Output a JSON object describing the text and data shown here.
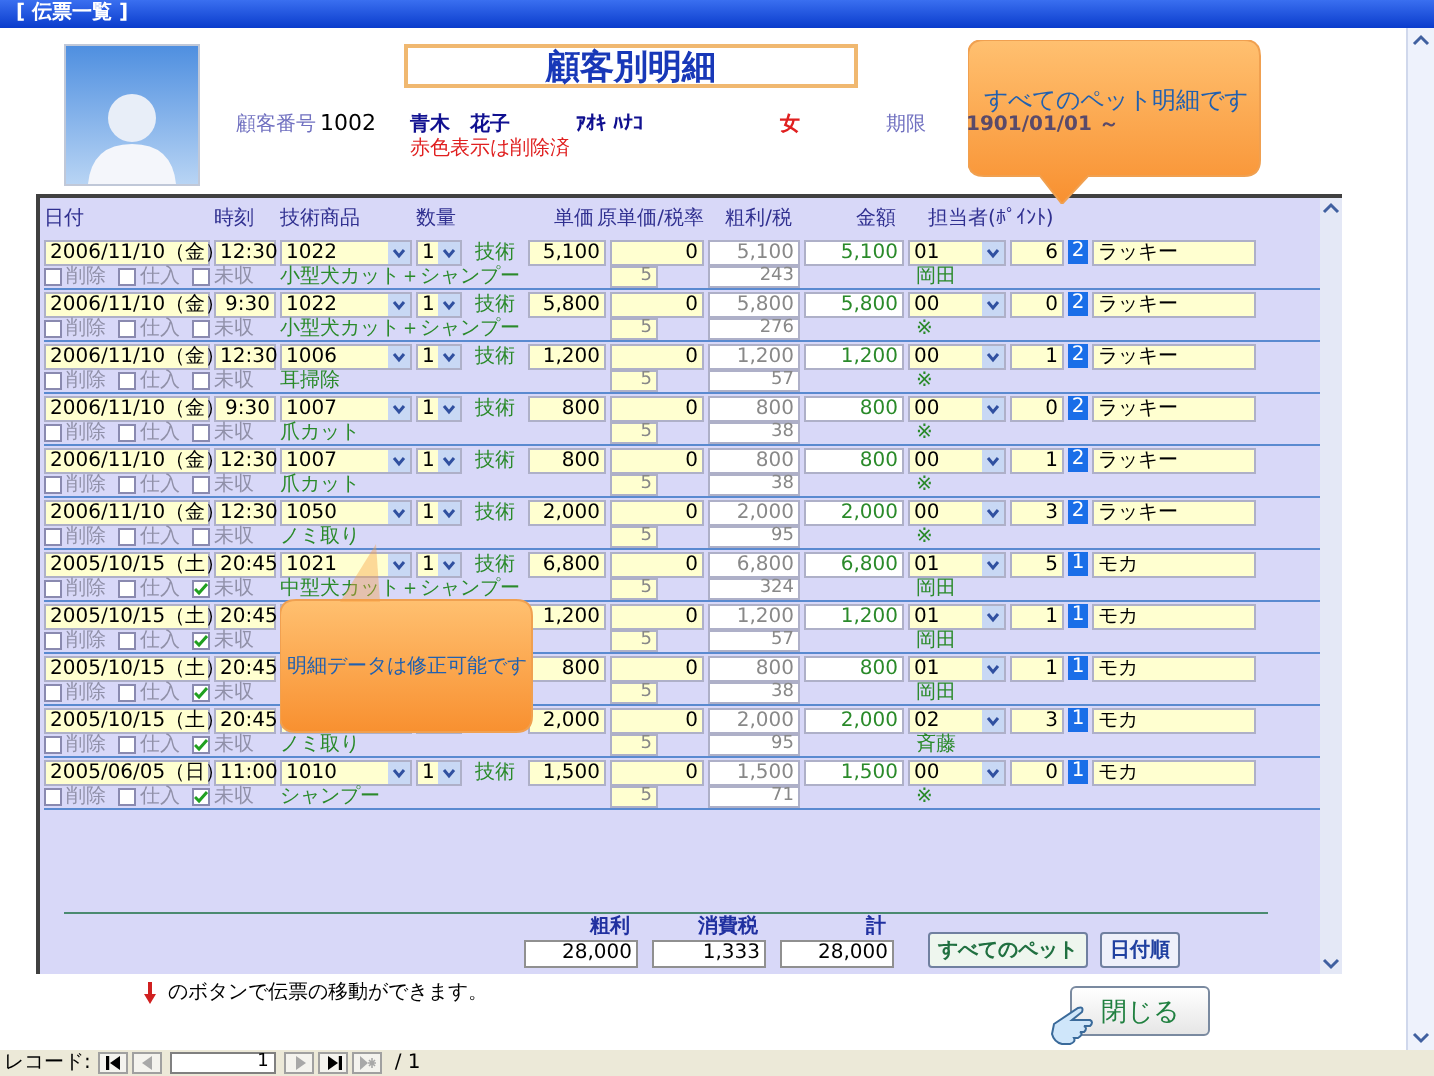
{
  "window": {
    "title": "[ 伝票一覧 ]"
  },
  "form_title": "顧客別明細",
  "customer": {
    "number_label": "顧客番号",
    "number": "1002",
    "name": "青木　花子",
    "deleted_note": "赤色表示は削除済",
    "kana": "ｱｵｷ ﾊﾅｺ",
    "gender": "女",
    "expiry_label": "期限",
    "expiry": "1901/01/01 ～"
  },
  "callouts": [
    {
      "text": "すべてのペット明細です"
    },
    {
      "text": "明細データは修正可能です"
    }
  ],
  "columns": [
    "日付",
    "時刻",
    "技術商品",
    "数量",
    "単価",
    "原単価/税率",
    "粗利/税",
    "金額",
    "担当者(ﾎﾟｲﾝﾄ)"
  ],
  "rows": [
    {
      "date": "2006/11/10（金）",
      "time": "12:30",
      "code": "1022",
      "qty": "1",
      "type": "技術",
      "unit_price": "5,100",
      "cost": "0",
      "gross": "5,100",
      "amount": "5,100",
      "staff_code": "01",
      "points": "6",
      "pet_no": "2",
      "pet": "ラッキー",
      "delete_label": "削除",
      "deleted": false,
      "purchase_label": "仕入",
      "purchase": false,
      "unpaid_label": "未収",
      "unpaid": false,
      "product": "小型犬カット＋シャンプー",
      "tax_rate": "5",
      "tax": "243",
      "staff": "岡田"
    },
    {
      "date": "2006/11/10（金）",
      "time": "9:30",
      "code": "1022",
      "qty": "1",
      "type": "技術",
      "unit_price": "5,800",
      "cost": "0",
      "gross": "5,800",
      "amount": "5,800",
      "staff_code": "00",
      "points": "0",
      "pet_no": "2",
      "pet": "ラッキー",
      "delete_label": "削除",
      "deleted": false,
      "purchase_label": "仕入",
      "purchase": false,
      "unpaid_label": "未収",
      "unpaid": false,
      "product": "小型犬カット＋シャンプー",
      "tax_rate": "5",
      "tax": "276",
      "staff": "※"
    },
    {
      "date": "2006/11/10（金）",
      "time": "12:30",
      "code": "1006",
      "qty": "1",
      "type": "技術",
      "unit_price": "1,200",
      "cost": "0",
      "gross": "1,200",
      "amount": "1,200",
      "staff_code": "00",
      "points": "1",
      "pet_no": "2",
      "pet": "ラッキー",
      "delete_label": "削除",
      "deleted": false,
      "purchase_label": "仕入",
      "purchase": false,
      "unpaid_label": "未収",
      "unpaid": false,
      "product": "耳掃除",
      "tax_rate": "5",
      "tax": "57",
      "staff": "※"
    },
    {
      "date": "2006/11/10（金）",
      "time": "9:30",
      "code": "1007",
      "qty": "1",
      "type": "技術",
      "unit_price": "800",
      "cost": "0",
      "gross": "800",
      "amount": "800",
      "staff_code": "00",
      "points": "0",
      "pet_no": "2",
      "pet": "ラッキー",
      "delete_label": "削除",
      "deleted": false,
      "purchase_label": "仕入",
      "purchase": false,
      "unpaid_label": "未収",
      "unpaid": false,
      "product": "爪カット",
      "tax_rate": "5",
      "tax": "38",
      "staff": "※"
    },
    {
      "date": "2006/11/10（金）",
      "time": "12:30",
      "code": "1007",
      "qty": "1",
      "type": "技術",
      "unit_price": "800",
      "cost": "0",
      "gross": "800",
      "amount": "800",
      "staff_code": "00",
      "points": "1",
      "pet_no": "2",
      "pet": "ラッキー",
      "delete_label": "削除",
      "deleted": false,
      "purchase_label": "仕入",
      "purchase": false,
      "unpaid_label": "未収",
      "unpaid": false,
      "product": "爪カット",
      "tax_rate": "5",
      "tax": "38",
      "staff": "※"
    },
    {
      "date": "2006/11/10（金）",
      "time": "12:30",
      "code": "1050",
      "qty": "1",
      "type": "技術",
      "unit_price": "2,000",
      "cost": "0",
      "gross": "2,000",
      "amount": "2,000",
      "staff_code": "00",
      "points": "3",
      "pet_no": "2",
      "pet": "ラッキー",
      "delete_label": "削除",
      "deleted": false,
      "purchase_label": "仕入",
      "purchase": false,
      "unpaid_label": "未収",
      "unpaid": false,
      "product": "ノミ取り",
      "tax_rate": "5",
      "tax": "95",
      "staff": "※"
    },
    {
      "date": "2005/10/15（土）",
      "time": "20:45",
      "code": "1021",
      "qty": "1",
      "type": "技術",
      "unit_price": "6,800",
      "cost": "0",
      "gross": "6,800",
      "amount": "6,800",
      "staff_code": "01",
      "points": "5",
      "pet_no": "1",
      "pet": "モカ",
      "delete_label": "削除",
      "deleted": false,
      "purchase_label": "仕入",
      "purchase": false,
      "unpaid_label": "未収",
      "unpaid": true,
      "product": "中型犬カット＋シャンプー",
      "tax_rate": "5",
      "tax": "324",
      "staff": "岡田"
    },
    {
      "date": "2005/10/15（土）",
      "time": "20:45",
      "unit_price": "1,200",
      "cost": "0",
      "gross": "1,200",
      "amount": "1,200",
      "staff_code": "01",
      "points": "1",
      "pet_no": "1",
      "pet": "モカ",
      "delete_label": "削除",
      "deleted": false,
      "purchase_label": "仕入",
      "purchase": false,
      "unpaid_label": "未収",
      "unpaid": true,
      "tax_rate": "5",
      "tax": "57",
      "staff": "岡田"
    },
    {
      "date": "2005/10/15（土）",
      "time": "20:45",
      "unit_price": "800",
      "cost": "0",
      "gross": "800",
      "amount": "800",
      "staff_code": "01",
      "points": "1",
      "pet_no": "1",
      "pet": "モカ",
      "delete_label": "削除",
      "deleted": false,
      "purchase_label": "仕入",
      "purchase": false,
      "unpaid_label": "未収",
      "unpaid": true,
      "tax_rate": "5",
      "tax": "38",
      "staff": "岡田"
    },
    {
      "date": "2005/10/15（土）",
      "time": "20:45",
      "unit_price": "2,000",
      "cost": "0",
      "gross": "2,000",
      "amount": "2,000",
      "staff_code": "02",
      "points": "3",
      "pet_no": "1",
      "pet": "モカ",
      "delete_label": "削除",
      "deleted": false,
      "purchase_label": "仕入",
      "purchase": false,
      "unpaid_label": "未収",
      "unpaid": true,
      "product": "ノミ取り",
      "tax_rate": "5",
      "tax": "95",
      "staff": "斉藤"
    },
    {
      "date": "2005/06/05（日）",
      "time": "11:00",
      "code": "1010",
      "qty": "1",
      "type": "技術",
      "unit_price": "1,500",
      "cost": "0",
      "gross": "1,500",
      "amount": "1,500",
      "staff_code": "00",
      "points": "0",
      "pet_no": "1",
      "pet": "モカ",
      "delete_label": "削除",
      "deleted": false,
      "purchase_label": "仕入",
      "purchase": false,
      "unpaid_label": "未収",
      "unpaid": true,
      "product": "シャンプー",
      "tax_rate": "5",
      "tax": "71",
      "staff": "※"
    }
  ],
  "totals": [
    {
      "label": "粗利",
      "value": "28,000"
    },
    {
      "label": "消費税",
      "value": "1,333"
    },
    {
      "label": "計",
      "value": "28,000"
    }
  ],
  "panel_buttons": [
    {
      "label": "すべてのペット"
    },
    {
      "label": "日付順"
    }
  ],
  "hint": "のボタンで伝票の移動ができます。",
  "close_button": "閉じる",
  "record_nav": {
    "label": "レコード:",
    "current": "1",
    "total": "/ 1",
    "buttons": [
      {
        "kind": "first",
        "disabled": false
      },
      {
        "kind": "prev",
        "disabled": true
      },
      {
        "kind": "next",
        "disabled": true
      },
      {
        "kind": "last",
        "disabled": false
      },
      {
        "kind": "new",
        "disabled": true
      }
    ]
  }
}
